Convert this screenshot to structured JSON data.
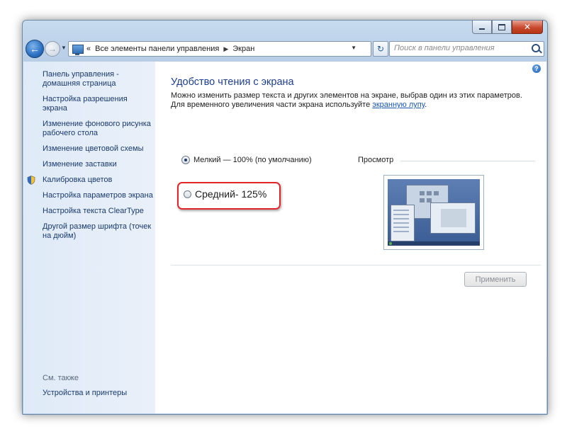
{
  "window": {
    "caption_buttons": [
      "minimize",
      "maximize",
      "close"
    ]
  },
  "navbar": {
    "breadcrumb_prefix": "«",
    "breadcrumb": [
      "Все элементы панели управления",
      "Экран"
    ],
    "search_placeholder": "Поиск в панели управления"
  },
  "sidebar": {
    "items": [
      {
        "label": "Панель управления - домашняя страница",
        "icon": null
      },
      {
        "label": "Настройка разрешения экрана",
        "icon": null
      },
      {
        "label": "Изменение фонового рисунка рабочего стола",
        "icon": null
      },
      {
        "label": "Изменение цветовой схемы",
        "icon": null
      },
      {
        "label": "Изменение заставки",
        "icon": null
      },
      {
        "label": "Калибровка цветов",
        "icon": "shield-icon"
      },
      {
        "label": "Настройка параметров экрана",
        "icon": null
      },
      {
        "label": "Настройка текста ClearType",
        "icon": null
      },
      {
        "label": "Другой размер шрифта (точек на дюйм)",
        "icon": null
      }
    ],
    "see_also_label": "См. также",
    "see_also_link": "Устройства и принтеры"
  },
  "main": {
    "title": "Удобство чтения с экрана",
    "desc_line1": "Можно изменить размер текста и других элементов на экране, выбрав один из этих параметров.",
    "desc_line2_prefix": "Для временного увеличения части экрана используйте ",
    "desc_link": "экранную лупу",
    "desc_line2_suffix": ".",
    "options": [
      {
        "label": "Мелкий — 100% (по умолчанию)",
        "selected": true
      },
      {
        "label": "Средний- 125%",
        "selected": false
      }
    ],
    "preview_label": "Просмотр",
    "apply_button": "Применить",
    "help_icon": "?"
  },
  "colors": {
    "highlight_box": "#e0262a",
    "link": "#1a3a6c",
    "title": "#1e3e8c"
  }
}
